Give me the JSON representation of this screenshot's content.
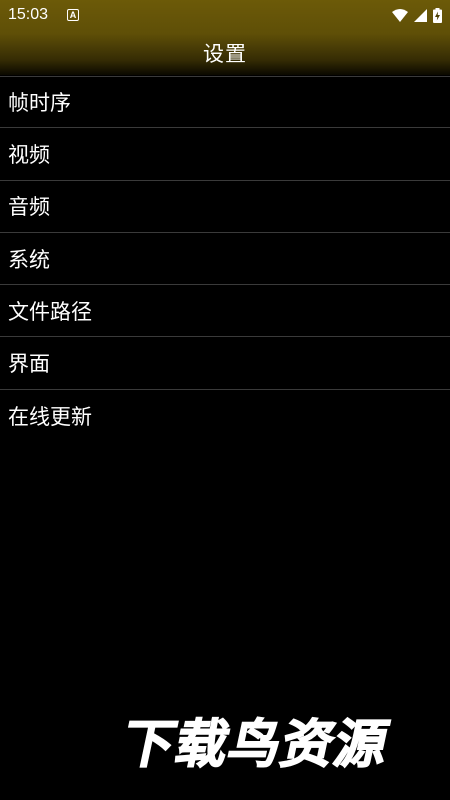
{
  "status_bar": {
    "time": "15:03",
    "notification_glyph": "A",
    "icons": [
      "wifi-icon",
      "signal-icon",
      "battery-charging-icon"
    ]
  },
  "header": {
    "title": "设置"
  },
  "menu": {
    "items": [
      {
        "label": "帧时序"
      },
      {
        "label": "视频"
      },
      {
        "label": "音频"
      },
      {
        "label": "系统"
      },
      {
        "label": "文件路径"
      },
      {
        "label": "界面"
      },
      {
        "label": "在线更新"
      }
    ]
  },
  "watermark": {
    "text": "下载鸟资源"
  },
  "colors": {
    "header_top": "#6c5a08",
    "background": "#000000",
    "divider": "#3a3a3a",
    "text": "#ffffff"
  }
}
